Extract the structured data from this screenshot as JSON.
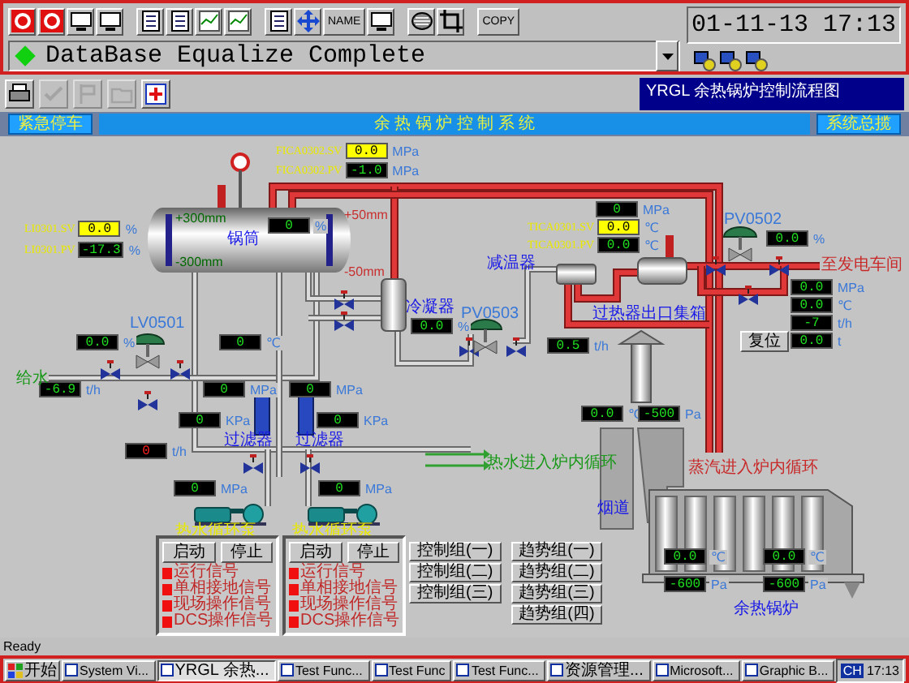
{
  "toolbar": [
    [
      {
        "kind": "alarm"
      },
      {
        "kind": "alarm"
      },
      {
        "kind": "monitor"
      },
      {
        "kind": "monitor"
      }
    ],
    [
      {
        "kind": "document"
      },
      {
        "kind": "document"
      },
      {
        "kind": "chart"
      },
      {
        "kind": "chart"
      }
    ],
    [
      {
        "kind": "document"
      },
      {
        "kind": "move"
      },
      {
        "kind": "text",
        "label": "NAME"
      },
      {
        "kind": "monitor"
      }
    ],
    [
      {
        "kind": "disk"
      },
      {
        "kind": "crop"
      }
    ],
    [
      {
        "kind": "text",
        "label": "COPY"
      }
    ]
  ],
  "clock": "01-11-13 17:13",
  "message": {
    "text": "DataBase Equalize Complete"
  },
  "tools": [
    {
      "kind": "printer",
      "disabled": false
    },
    {
      "kind": "check",
      "disabled": true
    },
    {
      "kind": "flag",
      "disabled": true
    },
    {
      "kind": "folder",
      "disabled": true
    },
    {
      "kind": "add",
      "disabled": false
    }
  ],
  "screen_title": "YRGL 余热锅炉控制流程图",
  "header": {
    "left_button": "紧急停车",
    "title": "余 热 锅 炉 控 制 系 统",
    "right_button": "系统总揽"
  },
  "readings": [
    {
      "label": "FICA0302.SV",
      "value": "0.0",
      "unit": "MPa",
      "kind": "setpoint"
    },
    {
      "label": "FICA0302.PV",
      "value": "-1.0",
      "unit": "MPa",
      "kind": "display"
    },
    {
      "label": "LI0301.SV",
      "value": "0.0",
      "unit": "%",
      "kind": "setpoint"
    },
    {
      "label": "LI0301.PV",
      "value": "-17.3",
      "unit": "%",
      "kind": "display"
    },
    {
      "value": "0",
      "unit": "%",
      "kind": "display"
    },
    {
      "value": "0.0",
      "unit": "%",
      "kind": "display"
    },
    {
      "value": "0",
      "unit": "℃",
      "kind": "display"
    },
    {
      "value": "-6.9",
      "unit": "t/h",
      "kind": "display"
    },
    {
      "value": "0",
      "unit": "MPa",
      "kind": "display"
    },
    {
      "value": "0",
      "unit": "MPa",
      "kind": "display"
    },
    {
      "value": "0.0",
      "unit": "%",
      "kind": "display"
    },
    {
      "value": "0",
      "unit": "MPa",
      "kind": "display"
    },
    {
      "label": "TICA0301.SV",
      "value": "0.0",
      "unit": "℃",
      "kind": "setpoint"
    },
    {
      "label": "TICA0301.PV",
      "value": "0.0",
      "unit": "℃",
      "kind": "display"
    },
    {
      "value": "0.0",
      "unit": "%",
      "kind": "display"
    },
    {
      "value": "0.0",
      "unit": "MPa",
      "kind": "display"
    },
    {
      "value": "0.0",
      "unit": "℃",
      "kind": "display"
    },
    {
      "value": "-7",
      "unit": "t/h",
      "kind": "display"
    },
    {
      "value": "0.0",
      "unit": "t",
      "kind": "display"
    },
    {
      "value": "0.5",
      "unit": "t/h",
      "kind": "display"
    },
    {
      "value": "0",
      "unit": "KPa",
      "kind": "display"
    },
    {
      "value": "0",
      "unit": "KPa",
      "kind": "display"
    },
    {
      "value": "0",
      "unit": "t/h",
      "kind": "alarm"
    },
    {
      "value": "0",
      "unit": "MPa",
      "kind": "display"
    },
    {
      "value": "0",
      "unit": "MPa",
      "kind": "display"
    },
    {
      "value": "0.0",
      "unit": "℃",
      "kind": "display"
    },
    {
      "value": "-500",
      "unit": "Pa",
      "kind": "display"
    },
    {
      "value": "0.0",
      "unit": "℃",
      "kind": "display"
    },
    {
      "value": "0.0",
      "unit": "℃",
      "kind": "display"
    },
    {
      "value": "-600",
      "unit": "Pa",
      "kind": "display"
    },
    {
      "value": "-600",
      "unit": "Pa",
      "kind": "display"
    }
  ],
  "labels": [
    {
      "text": "+50mm",
      "kind": "limit"
    },
    {
      "text": "-50mm",
      "kind": "limit"
    },
    {
      "text": "+300mm",
      "kind": "scale"
    },
    {
      "text": "-300mm",
      "kind": "scale"
    },
    {
      "text": "锅筒",
      "kind": "equipment"
    },
    {
      "text": "LV0501",
      "kind": "valve"
    },
    {
      "text": "给水",
      "kind": "water"
    },
    {
      "text": "冷凝器",
      "kind": "equipment"
    },
    {
      "text": "PV0503",
      "kind": "valve"
    },
    {
      "text": "减温器",
      "kind": "equipment"
    },
    {
      "text": "过热器出口集箱",
      "kind": "equipment"
    },
    {
      "text": "PV0502",
      "kind": "valve"
    },
    {
      "text": "至发电车间",
      "kind": "steam"
    },
    {
      "text": "过滤器",
      "kind": "equipment"
    },
    {
      "text": "过滤器",
      "kind": "equipment"
    },
    {
      "text": "热水循环泵",
      "kind": "pump"
    },
    {
      "text": "热水循环泵",
      "kind": "pump"
    },
    {
      "text": "热水进入炉内循环",
      "kind": "water"
    },
    {
      "text": "蒸汽进入炉内循环",
      "kind": "steam"
    },
    {
      "text": "烟道",
      "kind": "equipment"
    },
    {
      "text": "余热锅炉",
      "kind": "equipment"
    }
  ],
  "reset_button": "复位",
  "pump_panels": [
    {
      "buttons": [
        "启动",
        "停止"
      ],
      "signals": [
        {
          "text": "运行信号",
          "active": true
        },
        {
          "text": "单相接地信号",
          "active": true
        },
        {
          "text": "现场操作信号",
          "active": true
        },
        {
          "text": "DCS操作信号",
          "active": true
        }
      ]
    },
    {
      "buttons": [
        "启动",
        "停止"
      ],
      "signals": [
        {
          "text": "运行信号",
          "active": true
        },
        {
          "text": "单相接地信号",
          "active": true
        },
        {
          "text": "现场操作信号",
          "active": true
        },
        {
          "text": "DCS操作信号",
          "active": true
        }
      ]
    }
  ],
  "control_groups": [
    "控制组(一)",
    "控制组(二)",
    "控制组(三)"
  ],
  "trend_groups": [
    "趋势组(一)",
    "趋势组(二)",
    "趋势组(三)",
    "趋势组(四)"
  ],
  "status_bar": "Ready",
  "taskbar": {
    "start": "开始",
    "items": [
      {
        "label": "System Vi...",
        "selected": false
      },
      {
        "label": "YRGL 余热...",
        "selected": true
      },
      {
        "label": "Test Func...",
        "selected": false
      },
      {
        "label": "Test Func",
        "selected": false
      },
      {
        "label": "Test Func...",
        "selected": false
      },
      {
        "label": "资源管理...",
        "selected": false
      },
      {
        "label": "Microsoft...",
        "selected": false
      },
      {
        "label": "Graphic B...",
        "selected": false
      }
    ],
    "tray": "CH",
    "clock": "17:13"
  }
}
